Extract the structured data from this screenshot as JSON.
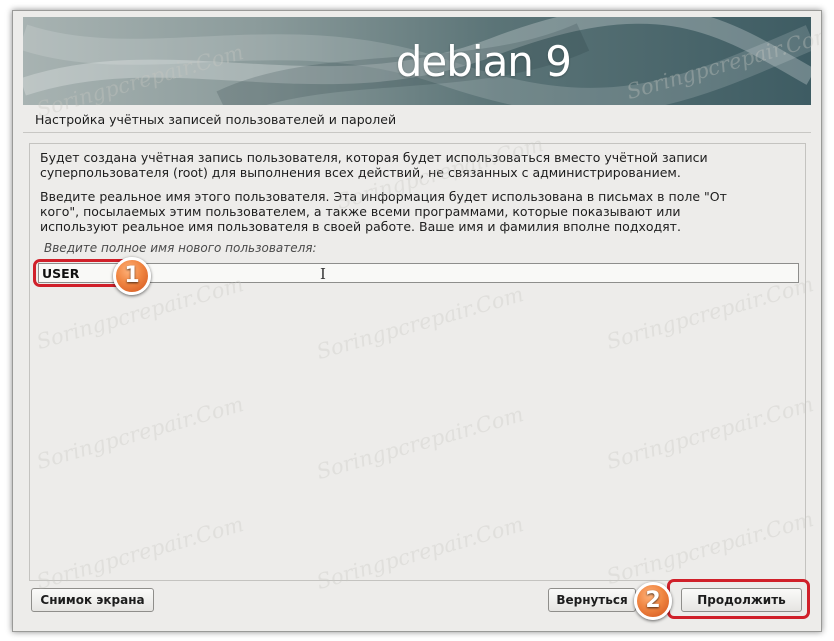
{
  "banner": {
    "title": "debian 9"
  },
  "page": {
    "title": "Настройка учётных записей пользователей и паролей"
  },
  "content": {
    "paragraph_1": "Будет создана учётная запись пользователя, которая будет использоваться вместо учётной записи\nсуперпользователя (root) для выполнения всех действий, не связанных с администрированием.",
    "paragraph_2": "Введите реальное имя этого пользователя. Эта информация будет использована в письмах в поле \"От\nкого\", посылаемых этим пользователем, а также всеми программами, которые показывают или\nиспользуют реальное имя пользователя в своей работе. Ваше имя и фамилия вполне подходят.",
    "field_label": "Введите полное имя нового пользователя:",
    "field_value": "USER"
  },
  "buttons": {
    "screenshot": "Снимок экрана",
    "back": "Вернуться",
    "continue": "Продолжить"
  },
  "annotations": {
    "marker_1": "1",
    "marker_2": "2",
    "color": "#d0202a",
    "marker_color": "#f08642"
  },
  "watermark": "Soringpcrepair.Com"
}
